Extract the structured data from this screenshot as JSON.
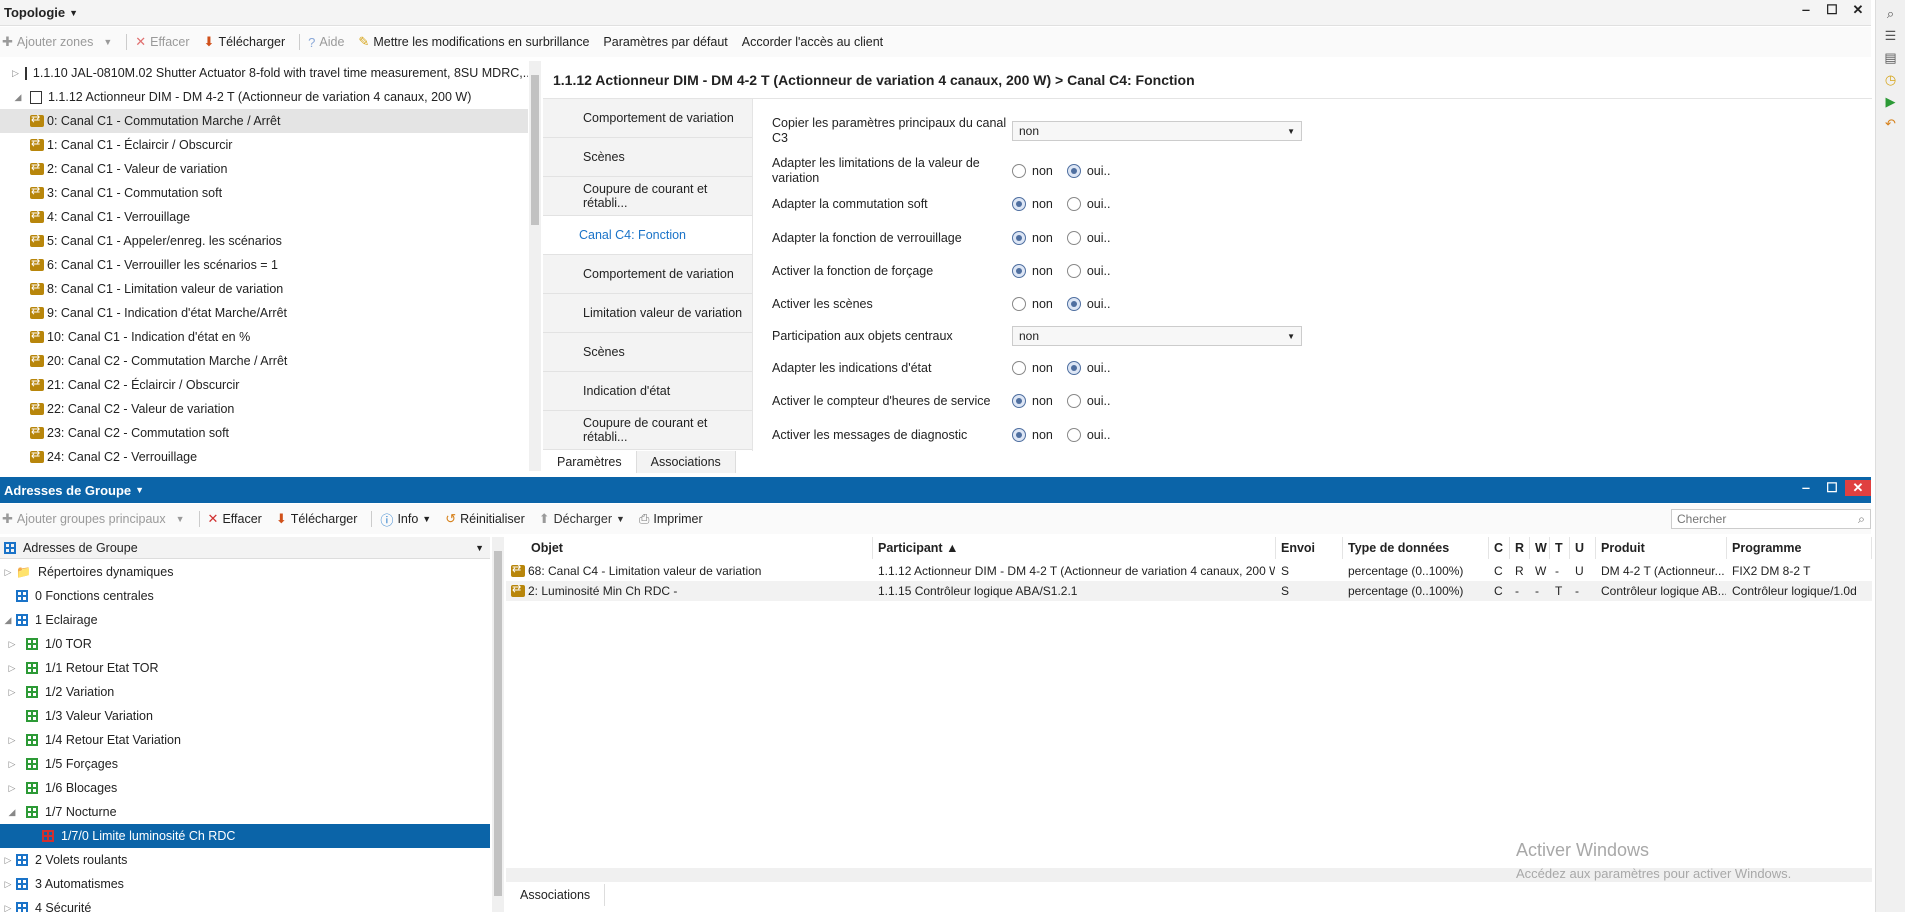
{
  "topology": {
    "title": "Topologie",
    "toolbar": {
      "add_zones": "Ajouter zones",
      "delete": "Effacer",
      "download": "Télécharger",
      "help": "Aide",
      "highlight": "Mettre les modifications en surbrillance",
      "defaults": "Paramètres par défaut",
      "client_access": "Accorder l'accès au client"
    },
    "tree": [
      {
        "label": "1.1.10 JAL-0810M.02 Shutter Actuator 8-fold with travel time measurement, 8SU MDRC,...",
        "kind": "device",
        "level": 1,
        "expander": "▷"
      },
      {
        "label": "1.1.12 Actionneur DIM - DM 4-2 T (Actionneur de variation 4 canaux, 200 W)",
        "kind": "device",
        "level": 1,
        "expander": "◢"
      },
      {
        "label": "0: Canal C1 - Commutation Marche / Arrêt",
        "kind": "obj",
        "level": 2,
        "selected": true
      },
      {
        "label": "1: Canal C1 - Éclaircir / Obscurcir",
        "kind": "obj",
        "level": 2
      },
      {
        "label": "2: Canal C1 - Valeur de variation",
        "kind": "obj",
        "level": 2
      },
      {
        "label": "3: Canal C1 - Commutation soft",
        "kind": "obj",
        "level": 2
      },
      {
        "label": "4: Canal C1 - Verrouillage",
        "kind": "obj",
        "level": 2
      },
      {
        "label": "5: Canal C1 - Appeler/enreg. les scénarios",
        "kind": "obj",
        "level": 2
      },
      {
        "label": "6: Canal C1 - Verrouiller les scénarios = 1",
        "kind": "obj",
        "level": 2
      },
      {
        "label": "8: Canal C1 - Limitation valeur de variation",
        "kind": "obj",
        "level": 2
      },
      {
        "label": "9: Canal C1 - Indication d'état Marche/Arrêt",
        "kind": "obj",
        "level": 2
      },
      {
        "label": "10: Canal C1 - Indication d'état en %",
        "kind": "obj",
        "level": 2
      },
      {
        "label": "20: Canal C2 - Commutation Marche / Arrêt",
        "kind": "obj",
        "level": 2
      },
      {
        "label": "21: Canal C2 - Éclaircir / Obscurcir",
        "kind": "obj",
        "level": 2
      },
      {
        "label": "22: Canal C2 - Valeur de variation",
        "kind": "obj",
        "level": 2
      },
      {
        "label": "23: Canal C2 - Commutation soft",
        "kind": "obj",
        "level": 2
      },
      {
        "label": "24: Canal C2 - Verrouillage",
        "kind": "obj",
        "level": 2
      }
    ],
    "param_header": "1.1.12 Actionneur DIM - DM 4-2 T (Actionneur de variation 4 canaux, 200 W) > Canal C4: Fonction",
    "side_tabs": [
      {
        "label": "Comportement de variation",
        "selected": false
      },
      {
        "label": "Scènes",
        "selected": false
      },
      {
        "label": "Coupure de courant et rétabli...",
        "selected": false
      },
      {
        "label": "Canal C4: Fonction",
        "selected": true
      },
      {
        "label": "Comportement de variation",
        "selected": false
      },
      {
        "label": "Limitation valeur de variation",
        "selected": false
      },
      {
        "label": "Scènes",
        "selected": false
      },
      {
        "label": "Indication d'état",
        "selected": false
      },
      {
        "label": "Coupure de courant et rétabli...",
        "selected": false
      }
    ],
    "params": [
      {
        "label": "Copier les paramètres principaux du canal C3",
        "type": "dropdown",
        "value": "non"
      },
      {
        "label": "Adapter les limitations de la valeur de variation",
        "type": "radio",
        "value": "oui.."
      },
      {
        "label": "Adapter la commutation soft",
        "type": "radio",
        "value": "non"
      },
      {
        "label": "Adapter la fonction de verrouillage",
        "type": "radio",
        "value": "non"
      },
      {
        "label": "Activer la fonction de forçage",
        "type": "radio",
        "value": "non"
      },
      {
        "label": "Activer les scènes",
        "type": "radio",
        "value": "oui.."
      },
      {
        "label": "Participation aux objets centraux",
        "type": "dropdown",
        "value": "non"
      },
      {
        "label": "Adapter les indications d'état",
        "type": "radio",
        "value": "oui.."
      },
      {
        "label": "Activer le compteur d'heures de service",
        "type": "radio",
        "value": "non"
      },
      {
        "label": "Activer les messages de diagnostic",
        "type": "radio",
        "value": "non"
      }
    ],
    "radio_no": "non",
    "radio_yes": "oui..",
    "bottom_tabs": [
      "Paramètres",
      "Associations"
    ]
  },
  "groups": {
    "title": "Adresses de Groupe",
    "toolbar": {
      "add_main": "Ajouter groupes principaux",
      "delete": "Effacer",
      "download": "Télécharger",
      "info": "Info",
      "reset": "Réinitialiser",
      "unload": "Décharger",
      "print": "Imprimer",
      "search_placeholder": "Chercher"
    },
    "tree_header": "Adresses de Groupe",
    "tree": [
      {
        "label": "Répertoires dynamiques",
        "icon": "folder",
        "level": 0,
        "expander": "▷"
      },
      {
        "label": "0 Fonctions centrales",
        "icon": "blue",
        "level": 0,
        "expander": ""
      },
      {
        "label": "1 Eclairage",
        "icon": "blue",
        "level": 0,
        "expander": "◢"
      },
      {
        "label": "1/0 TOR",
        "icon": "green",
        "level": 1,
        "expander": "▷"
      },
      {
        "label": "1/1 Retour Etat TOR",
        "icon": "green",
        "level": 1,
        "expander": "▷"
      },
      {
        "label": "1/2 Variation",
        "icon": "green",
        "level": 1,
        "expander": "▷"
      },
      {
        "label": "1/3 Valeur Variation",
        "icon": "green",
        "level": 1,
        "expander": ""
      },
      {
        "label": "1/4 Retour Etat Variation",
        "icon": "green",
        "level": 1,
        "expander": "▷"
      },
      {
        "label": "1/5 Forçages",
        "icon": "green",
        "level": 1,
        "expander": "▷"
      },
      {
        "label": "1/6 Blocages",
        "icon": "green",
        "level": 1,
        "expander": "▷"
      },
      {
        "label": "1/7 Nocturne",
        "icon": "green",
        "level": 1,
        "expander": "◢"
      },
      {
        "label": "1/7/0 Limite luminosité Ch RDC",
        "icon": "red",
        "level": 2,
        "expander": "",
        "selected": true
      },
      {
        "label": "2 Volets roulants",
        "icon": "blue",
        "level": 0,
        "expander": "▷"
      },
      {
        "label": "3 Automatismes",
        "icon": "blue",
        "level": 0,
        "expander": "▷"
      },
      {
        "label": "4 Sécurité",
        "icon": "blue",
        "level": 0,
        "expander": "▷"
      }
    ],
    "columns": [
      "Objet",
      "Participant ▲",
      "Envoi",
      "Type de données",
      "C",
      "R",
      "W",
      "T",
      "U",
      "Produit",
      "Programme"
    ],
    "rows": [
      [
        "68: Canal C4 - Limitation valeur de variation",
        "1.1.12 Actionneur DIM - DM 4-2 T (Actionneur de variation 4 canaux, 200 W)",
        "S",
        "percentage (0..100%)",
        "C",
        "R",
        "W",
        "-",
        "U",
        "DM 4-2 T (Actionneur...",
        "FIX2 DM 8-2 T"
      ],
      [
        "2: Luminosité Min Ch RDC -",
        "1.1.15 Contrôleur logique ABA/S1.2.1",
        "S",
        "percentage (0..100%)",
        "C",
        "-",
        "-",
        "T",
        "-",
        "Contrôleur logique AB...",
        "Contrôleur logique/1.0d"
      ]
    ],
    "bottom_tab": "Associations",
    "watermark_title": "Activer Windows",
    "watermark_sub": "Accédez aux paramètres pour activer Windows."
  }
}
